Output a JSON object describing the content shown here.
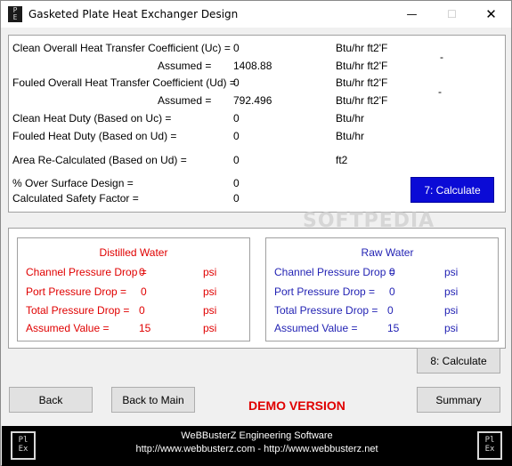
{
  "window": {
    "title": "Gasketed Plate Heat Exchanger Design",
    "icon": "plex-logo-icon",
    "minimize": "—",
    "maximize": "☐",
    "close": "✕"
  },
  "main": {
    "rows": [
      {
        "label": "Clean Overall Heat Transfer Coefficient (Uc) =",
        "value": "0",
        "unit": "Btu/hr ft2'F"
      },
      {
        "label": "Assumed =",
        "value": "1408.88",
        "unit": "Btu/hr ft2'F"
      },
      {
        "label": "Fouled Overall Heat Transfer Coefficient (Ud) =",
        "value": "0",
        "unit": "Btu/hr ft2'F"
      },
      {
        "label": "Assumed =",
        "value": "792.496",
        "unit": "Btu/hr ft2'F"
      },
      {
        "label": "Clean Heat Duty (Based on Uc) =",
        "value": "0",
        "unit": "Btu/hr"
      },
      {
        "label": "Fouled Heat Duty (Based on Ud) =",
        "value": "0",
        "unit": "Btu/hr"
      },
      {
        "label": "Area Re-Calculated (Based on Ud) =",
        "value": "0",
        "unit": "ft2"
      },
      {
        "label": "% Over Surface Design =",
        "value": "0",
        "unit": ""
      },
      {
        "label": "Calculated Safety Factor =",
        "value": "0",
        "unit": ""
      }
    ],
    "dash1": "-",
    "dash2": "-",
    "calc7_label": "7: Calculate",
    "watermark": "SOFTPEDIA"
  },
  "distilled": {
    "title": "Distilled Water",
    "rows": [
      {
        "label": "Channel Pressure Drop =",
        "value": "0",
        "unit": "psi"
      },
      {
        "label": "Port Pressure Drop =",
        "value": "0",
        "unit": "psi"
      },
      {
        "label": "Total Pressure Drop =",
        "value": "0",
        "unit": "psi"
      },
      {
        "label": "Assumed Value =",
        "value": "15",
        "unit": "psi"
      }
    ]
  },
  "raw": {
    "title": "Raw Water",
    "rows": [
      {
        "label": "Channel Pressure Drop =",
        "value": "0",
        "unit": "psi"
      },
      {
        "label": "Port Pressure Drop =",
        "value": "0",
        "unit": "psi"
      },
      {
        "label": "Total Pressure Drop =",
        "value": "0",
        "unit": "psi"
      },
      {
        "label": "Assumed Value =",
        "value": "15",
        "unit": "psi"
      }
    ]
  },
  "buttons": {
    "calc8": "8: Calculate",
    "back": "Back",
    "back_main": "Back to Main",
    "summary": "Summary"
  },
  "demo": "DEMO VERSION",
  "footer": {
    "line1": "WeBBusterZ Engineering Software",
    "line2": "http://www.webbusterz.com - http://www.webbusterz.net",
    "logo_text": "PlEx"
  },
  "colors": {
    "distilled": "#e00000",
    "raw": "#2323b4",
    "calc7_bg": "#0b0bd6",
    "footer_bg": "#000000"
  }
}
